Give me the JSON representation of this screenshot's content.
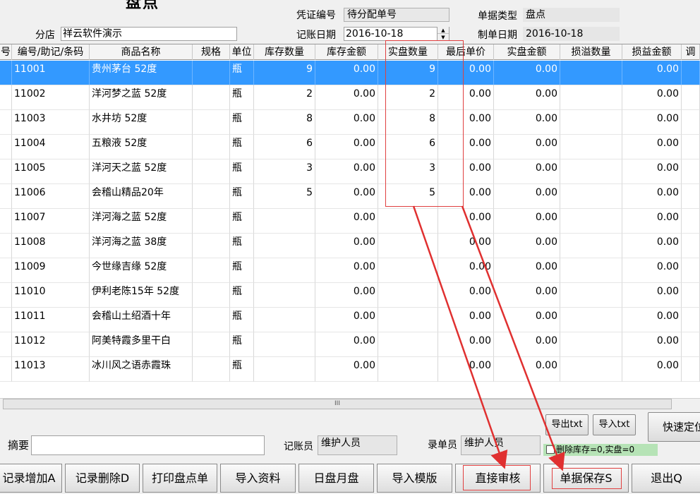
{
  "header": {
    "title": "盘点",
    "voucher_label": "凭证编号",
    "voucher_value": "待分配单号",
    "doctype_label": "单据类型",
    "doctype_value": "盘点",
    "store_label": "分店",
    "store_value": "祥云软件演示",
    "book_date_label": "记账日期",
    "book_date_value": "2016-10-18",
    "make_date_label": "制单日期",
    "make_date_value": "2016-10-18"
  },
  "table": {
    "columns": [
      "号",
      "编号/助记/条码",
      "商品名称",
      "规格",
      "单位",
      "库存数量",
      "库存金额",
      "实盘数量",
      "最后单价",
      "实盘金额",
      "损溢数量",
      "损益金额",
      "调"
    ],
    "rows": [
      [
        "",
        "11001",
        "贵州茅台 52度",
        "",
        "瓶",
        "9",
        "0.00",
        "9",
        "0.00",
        "0.00",
        "",
        "0.00",
        ""
      ],
      [
        "",
        "11002",
        "洋河梦之蓝 52度",
        "",
        "瓶",
        "2",
        "0.00",
        "2",
        "0.00",
        "0.00",
        "",
        "0.00",
        ""
      ],
      [
        "",
        "11003",
        "水井坊 52度",
        "",
        "瓶",
        "8",
        "0.00",
        "8",
        "0.00",
        "0.00",
        "",
        "0.00",
        ""
      ],
      [
        "",
        "11004",
        "五粮液 52度",
        "",
        "瓶",
        "6",
        "0.00",
        "6",
        "0.00",
        "0.00",
        "",
        "0.00",
        ""
      ],
      [
        "",
        "11005",
        "洋河天之蓝 52度",
        "",
        "瓶",
        "3",
        "0.00",
        "3",
        "0.00",
        "0.00",
        "",
        "0.00",
        ""
      ],
      [
        "",
        "11006",
        "会稽山精品20年",
        "",
        "瓶",
        "5",
        "0.00",
        "5",
        "0.00",
        "0.00",
        "",
        "0.00",
        ""
      ],
      [
        "",
        "11007",
        "洋河海之蓝 52度",
        "",
        "瓶",
        "",
        "0.00",
        "",
        "0.00",
        "0.00",
        "",
        "0.00",
        ""
      ],
      [
        "",
        "11008",
        "洋河海之蓝 38度",
        "",
        "瓶",
        "",
        "0.00",
        "",
        "0.00",
        "0.00",
        "",
        "0.00",
        ""
      ],
      [
        "",
        "11009",
        "今世缘吉缘 52度",
        "",
        "瓶",
        "",
        "0.00",
        "",
        "0.00",
        "0.00",
        "",
        "0.00",
        ""
      ],
      [
        "",
        "11010",
        "伊利老陈15年 52度",
        "",
        "瓶",
        "",
        "0.00",
        "",
        "0.00",
        "0.00",
        "",
        "0.00",
        ""
      ],
      [
        "",
        "11011",
        "会稽山土绍酒十年",
        "",
        "瓶",
        "",
        "0.00",
        "",
        "0.00",
        "0.00",
        "",
        "0.00",
        ""
      ],
      [
        "",
        "11012",
        "阿美特霞多里干白",
        "",
        "瓶",
        "",
        "0.00",
        "",
        "0.00",
        "0.00",
        "",
        "0.00",
        ""
      ],
      [
        "",
        "11013",
        "冰川风之语赤霞珠",
        "",
        "瓶",
        "",
        "0.00",
        "",
        "0.00",
        "0.00",
        "",
        "0.00",
        ""
      ]
    ]
  },
  "scrollbar": {
    "grip": "III"
  },
  "side_buttons": {
    "export_txt": "导出txt",
    "import_txt": "导入txt",
    "quick_locate": "快速定位"
  },
  "footer": {
    "summary_label": "摘要",
    "summary_value": "",
    "bookkeeper_label": "记账员",
    "bookkeeper_value": "维护人员",
    "entry_label": "录单员",
    "entry_value": "维护人员",
    "delete_zero_note": "删除库存=0,实盘=0"
  },
  "bottom_buttons": [
    "记录增加A",
    "记录删除D",
    "打印盘点单",
    "导入资料",
    "日盘月盘",
    "导入模版",
    "直接审核",
    "单据保存S",
    "退出Q"
  ],
  "colors": {
    "selection": "#3399ff",
    "annotation": "#e04040",
    "note_bg": "#b6e3b6"
  }
}
